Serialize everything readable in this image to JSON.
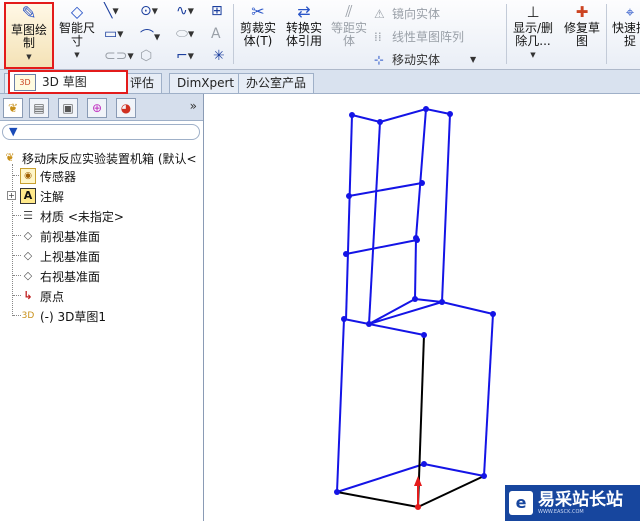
{
  "ribbon": {
    "sketch": {
      "label": "草图绘\n制"
    },
    "smart_dim": {
      "label": "智能尺\n寸"
    },
    "trim": {
      "label": "剪裁实\n体(T)"
    },
    "convert": {
      "label": "转换实\n体引用"
    },
    "offset": {
      "label": "等距实\n体"
    },
    "mirror": {
      "label": "镜向实体"
    },
    "linear_pattern": {
      "label": "线性草图阵列"
    },
    "move": {
      "label": "移动实体"
    },
    "show_delete": {
      "label": "显示/删\n除几..."
    },
    "repair": {
      "label": "修复草\n图"
    },
    "quick": {
      "label": "快速捕\n捉"
    }
  },
  "tabs": {
    "active": "3D 草图",
    "items": [
      "评估",
      "DimXpert",
      "办公室产品"
    ],
    "icon_text": "3D"
  },
  "panel": {
    "expand_label": "»",
    "tree": {
      "root": "移动床反应实验装置机箱 (默认<",
      "sensors": "传感器",
      "annotations": "注解",
      "material": "材质 <未指定>",
      "front_plane": "前视基准面",
      "top_plane": "上视基准面",
      "right_plane": "右视基准面",
      "origin": "原点",
      "sketch3d": "(-) 3D草图1"
    }
  },
  "watermark": {
    "title": "易采站长站",
    "subtitle": "WWW.EASCK.COM"
  },
  "colors": {
    "sketch_line": "#1414e6",
    "active_line": "#000000",
    "highlight_red": "#e31b1b"
  }
}
